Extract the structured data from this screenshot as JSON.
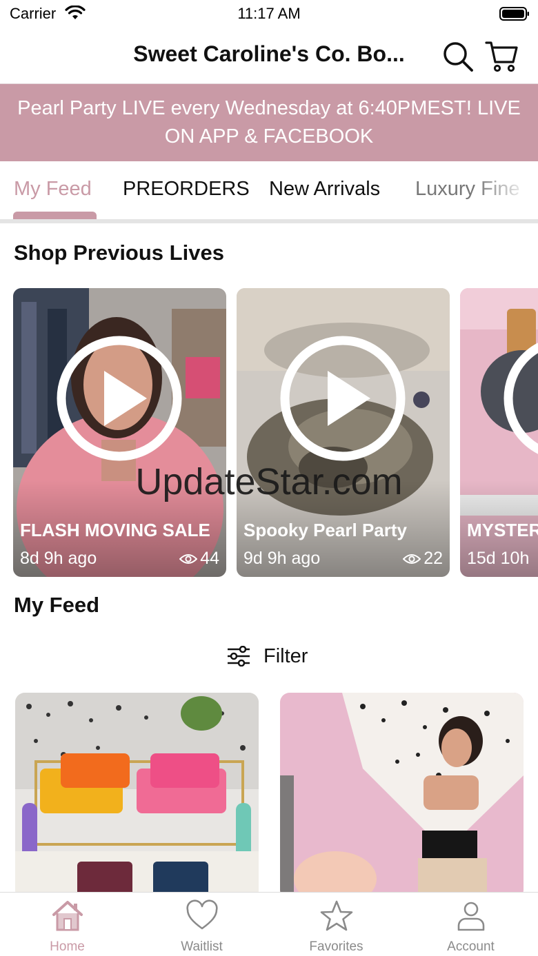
{
  "status_bar": {
    "carrier": "Carrier",
    "time": "11:17 AM"
  },
  "header": {
    "title": "Sweet Caroline's Co. Bo...",
    "icons": [
      "search-icon",
      "cart-icon"
    ]
  },
  "banner": {
    "text": "Pearl Party LIVE every Wednesday at 6:40PMEST! LIVE ON APP & FACEBOOK",
    "color": "#c99aa6"
  },
  "tabs": [
    {
      "label": "My Feed",
      "active": true
    },
    {
      "label": "PREORDERS",
      "active": false
    },
    {
      "label": "New Arrivals",
      "active": false
    },
    {
      "label": "Luxury Fine",
      "active": false
    }
  ],
  "previous_lives": {
    "title": "Shop Previous Lives",
    "items": [
      {
        "title": "FLASH MOVING SALE",
        "time": "8d 9h ago",
        "views": "44"
      },
      {
        "title": "Spooky Pearl Party",
        "time": "9d 9h ago",
        "views": "22"
      },
      {
        "title": "MYSTER",
        "time": "15d 10h"
      }
    ]
  },
  "watermark": "UpdateStar.com",
  "feed": {
    "title": "My Feed",
    "filter_label": "Filter"
  },
  "bottom_nav": [
    {
      "label": "Home",
      "icon": "home-icon",
      "active": true
    },
    {
      "label": "Waitlist",
      "icon": "heart-icon",
      "active": false
    },
    {
      "label": "Favorites",
      "icon": "star-icon",
      "active": false
    },
    {
      "label": "Account",
      "icon": "person-icon",
      "active": false
    }
  ],
  "colors": {
    "accent": "#c99aa6",
    "inactive": "#8a8a8a"
  }
}
